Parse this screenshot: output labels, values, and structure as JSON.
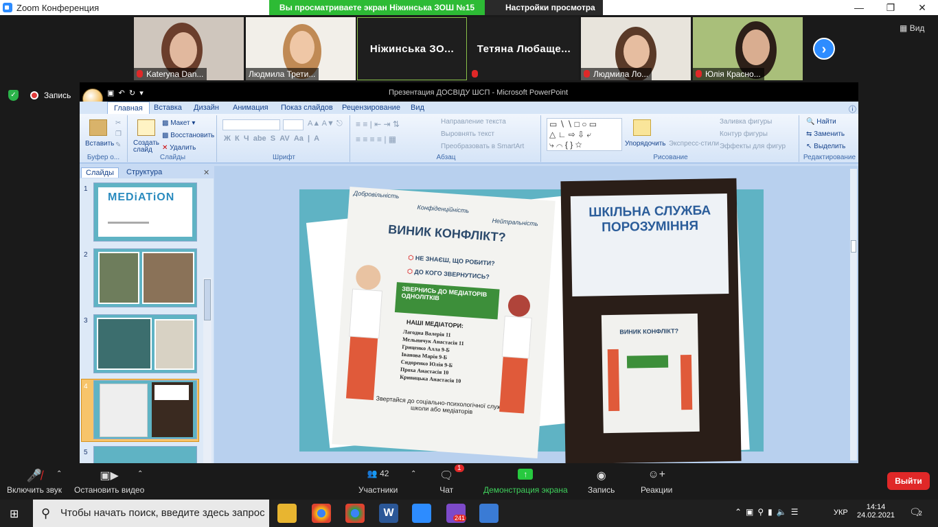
{
  "window": {
    "app_title": "Zoom Конференция",
    "share_banner": "Вы просматриваете экран Ніжинська ЗОШ №15",
    "view_options": "Настройки просмотра"
  },
  "participants": [
    {
      "name": "Kateryna Dan..."
    },
    {
      "name": "Людмила Трети..."
    },
    {
      "name": "Ніжинська  ЗО..."
    },
    {
      "name": "Тетяна  Любаще..."
    },
    {
      "name": "Людмила Ло..."
    },
    {
      "name": "Юлія Красно..."
    }
  ],
  "view_button": "Вид",
  "recording_label": "Запись",
  "ppt": {
    "title": "Презентация ДОСВІДУ ШСП - Microsoft PowerPoint",
    "tabs": [
      "Главная",
      "Вставка",
      "Дизайн",
      "Анимация",
      "Показ слайдов",
      "Рецензирование",
      "Вид"
    ],
    "groups": {
      "clipboard": {
        "label": "Буфер о...",
        "paste": "Вставить"
      },
      "slides": {
        "label": "Слайды",
        "create": "Создать слайд",
        "layout": "Макет",
        "restore": "Восстановить",
        "delete": "Удалить"
      },
      "font": {
        "label": "Шрифт"
      },
      "paragraph": {
        "label": "Абзац",
        "dir": "Направление текста",
        "align": "Выровнять текст",
        "smartart": "Преобразовать в SmartArt"
      },
      "drawing": {
        "label": "Рисование",
        "arrange": "Упорядочить",
        "styles": "Экспресс-стили",
        "fill": "Заливка фигуры",
        "outline": "Контур фигуры",
        "effects": "Эффекты для фигур"
      },
      "editing": {
        "label": "Редактирование",
        "find": "Найти",
        "replace": "Заменить",
        "select": "Выделить"
      }
    },
    "pane_tabs": [
      "Слайды",
      "Структура"
    ],
    "slide_numbers": [
      "1",
      "2",
      "3",
      "4",
      "5"
    ],
    "thumb1_title": "MEDiATiON",
    "poster_left": {
      "tags": [
        "Добровільність",
        "Конфіденційність",
        "Нейтральність"
      ],
      "headline": "ВИНИК КОНФЛІКТ?",
      "q1": "НЕ ЗНАЄШ, ЩО РОБИТИ?",
      "q2": "ДО КОГО ЗВЕРНУТИСЬ?",
      "cta": "ЗВЕРНИСЬ ДО МЕДІАТОРІВ ОДНОЛІТКІВ",
      "mediators_title": "НАШІ МЕДІАТОРИ:",
      "mediators": [
        "Лагодна Валерія 11",
        "Мельничук Анастасія 11",
        "Гриценко Алла 9-Б",
        "Іванова Марія 9-Б",
        "Сидоренко Юлія 9-Б",
        "Проха Анастасія 10",
        "Кривицька Анастасія 10"
      ],
      "footer": "Звертайся до соціально-психологічної служби школи або медіаторів"
    },
    "poster_right": {
      "title": "ШКІЛЬНА СЛУЖБА ПОРОЗУМІННЯ",
      "mini_headline": "ВИНИК КОНФЛІКТ?"
    }
  },
  "toolbar": {
    "mute": "Включить звук",
    "video": "Остановить видео",
    "participants": "Участники",
    "participants_count": "42",
    "chat": "Чат",
    "chat_badge": "1",
    "share": "Демонстрация экрана",
    "record": "Запись",
    "reactions": "Реакции",
    "leave": "Выйти"
  },
  "taskbar": {
    "search_placeholder": "Чтобы начать поиск, введите здесь запрос",
    "lang": "УКР",
    "time": "14:14",
    "date": "24.02.2021",
    "notif_count": "2",
    "viber_badge": "241"
  },
  "colors": {
    "zoom_blue": "#2d8cff",
    "share_green": "#2dbb35",
    "leave_red": "#e02828",
    "slide_teal": "#5fb3c4",
    "poster_green": "#3d8f3a"
  }
}
